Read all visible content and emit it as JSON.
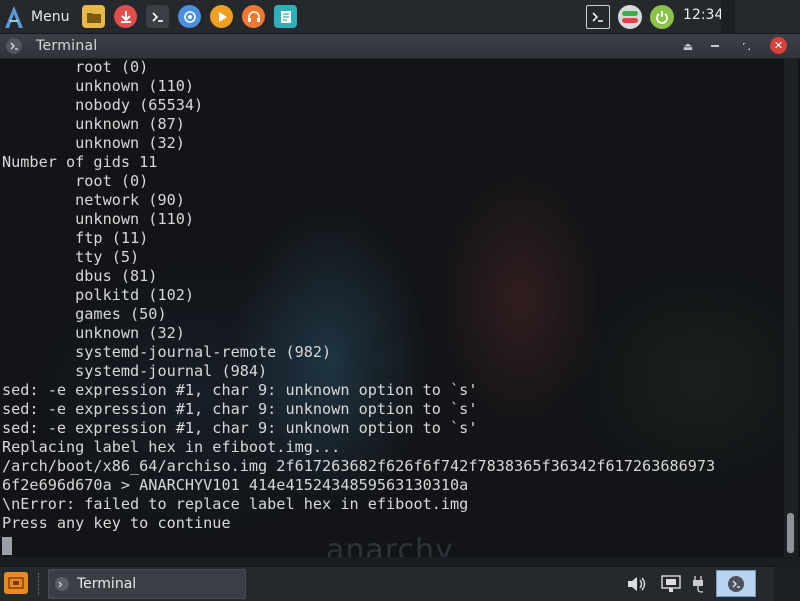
{
  "top_panel": {
    "menu_label": "Menu",
    "launchers": [
      {
        "name": "files-icon",
        "color": "#e8b84a"
      },
      {
        "name": "installer-icon",
        "color": "#e24d4d"
      },
      {
        "name": "terminal-launcher-icon",
        "color": "#3b3f45"
      },
      {
        "name": "browser-icon",
        "color": "#4a8fe0"
      },
      {
        "name": "media-player-icon",
        "color": "#f0a020"
      },
      {
        "name": "audio-player-icon",
        "color": "#f07830"
      },
      {
        "name": "text-editor-icon",
        "color": "#2fb0b8"
      }
    ],
    "clock": "12:34"
  },
  "window": {
    "title": "Terminal"
  },
  "terminal": {
    "lines": [
      "        root (0)",
      "        unknown (110)",
      "        nobody (65534)",
      "        unknown (87)",
      "        unknown (32)",
      "Number of gids 11",
      "        root (0)",
      "        network (90)",
      "        unknown (110)",
      "        ftp (11)",
      "        tty (5)",
      "        dbus (81)",
      "        polkitd (102)",
      "        games (50)",
      "        unknown (32)",
      "        systemd-journal-remote (982)",
      "        systemd-journal (984)",
      "sed: -e expression #1, char 9: unknown option to `s'",
      "sed: -e expression #1, char 9: unknown option to `s'",
      "sed: -e expression #1, char 9: unknown option to `s'",
      "Replacing label hex in efiboot.img...",
      "/arch/boot/x86_64/archiso.img 2f617263682f626f6f742f7838365f36342f617263686973",
      "6f2e696d670a > ANARCHYV101 414e4152434859563130310a",
      "\\nError: failed to replace label hex in efiboot.img",
      "Press any key to continue"
    ],
    "watermark": "anarchy"
  },
  "taskbar": {
    "task_label": "Terminal"
  },
  "colors": {
    "panel_bg": "#25282d",
    "terminal_bg": "#121417",
    "text": "#d8d8d8",
    "close_button": "#d8413a",
    "active_task": "#b9d4ee"
  }
}
